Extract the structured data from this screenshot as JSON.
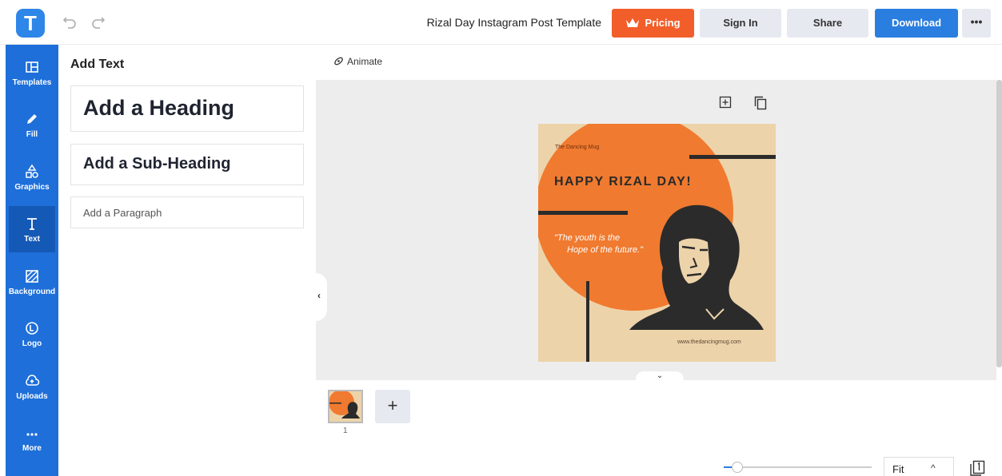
{
  "app": {
    "logo_letter": "T"
  },
  "header": {
    "title": "Rizal Day Instagram Post Template",
    "pricing_label": "Pricing",
    "signin_label": "Sign In",
    "share_label": "Share",
    "download_label": "Download",
    "more_label": "•••"
  },
  "sidebar": {
    "items": [
      {
        "label": "Templates",
        "icon": "templates-icon"
      },
      {
        "label": "Fill",
        "icon": "pencil-icon"
      },
      {
        "label": "Graphics",
        "icon": "shapes-icon"
      },
      {
        "label": "Text",
        "icon": "text-icon",
        "active": true
      },
      {
        "label": "Background",
        "icon": "background-icon"
      },
      {
        "label": "Logo",
        "icon": "logo-icon"
      },
      {
        "label": "Uploads",
        "icon": "cloud-upload-icon"
      },
      {
        "label": "More",
        "icon": "more-dots-icon"
      }
    ]
  },
  "panel": {
    "title": "Add Text",
    "heading_label": "Add a Heading",
    "subheading_label": "Add a Sub-Heading",
    "paragraph_label": "Add a Paragraph"
  },
  "canvas": {
    "animate_label": "Animate",
    "design": {
      "brand": "The Dancing Mug",
      "headline": "HAPPY RIZAL DAY!",
      "quote_line1": "\"The youth is the",
      "quote_line2": "Hope of the future.\"",
      "website": "www.thedancingmug.com",
      "colors": {
        "orange": "#f07a2f",
        "beige": "#edd3aa",
        "dark": "#2b2b2b"
      }
    }
  },
  "pages": {
    "current_page_number": "1",
    "add_page_label": "+"
  },
  "zoom": {
    "label": "Fit",
    "caret": "^"
  },
  "colors": {
    "accent": "#1e6fd9",
    "pricing": "#f25e2a",
    "download": "#2a7ee0"
  }
}
